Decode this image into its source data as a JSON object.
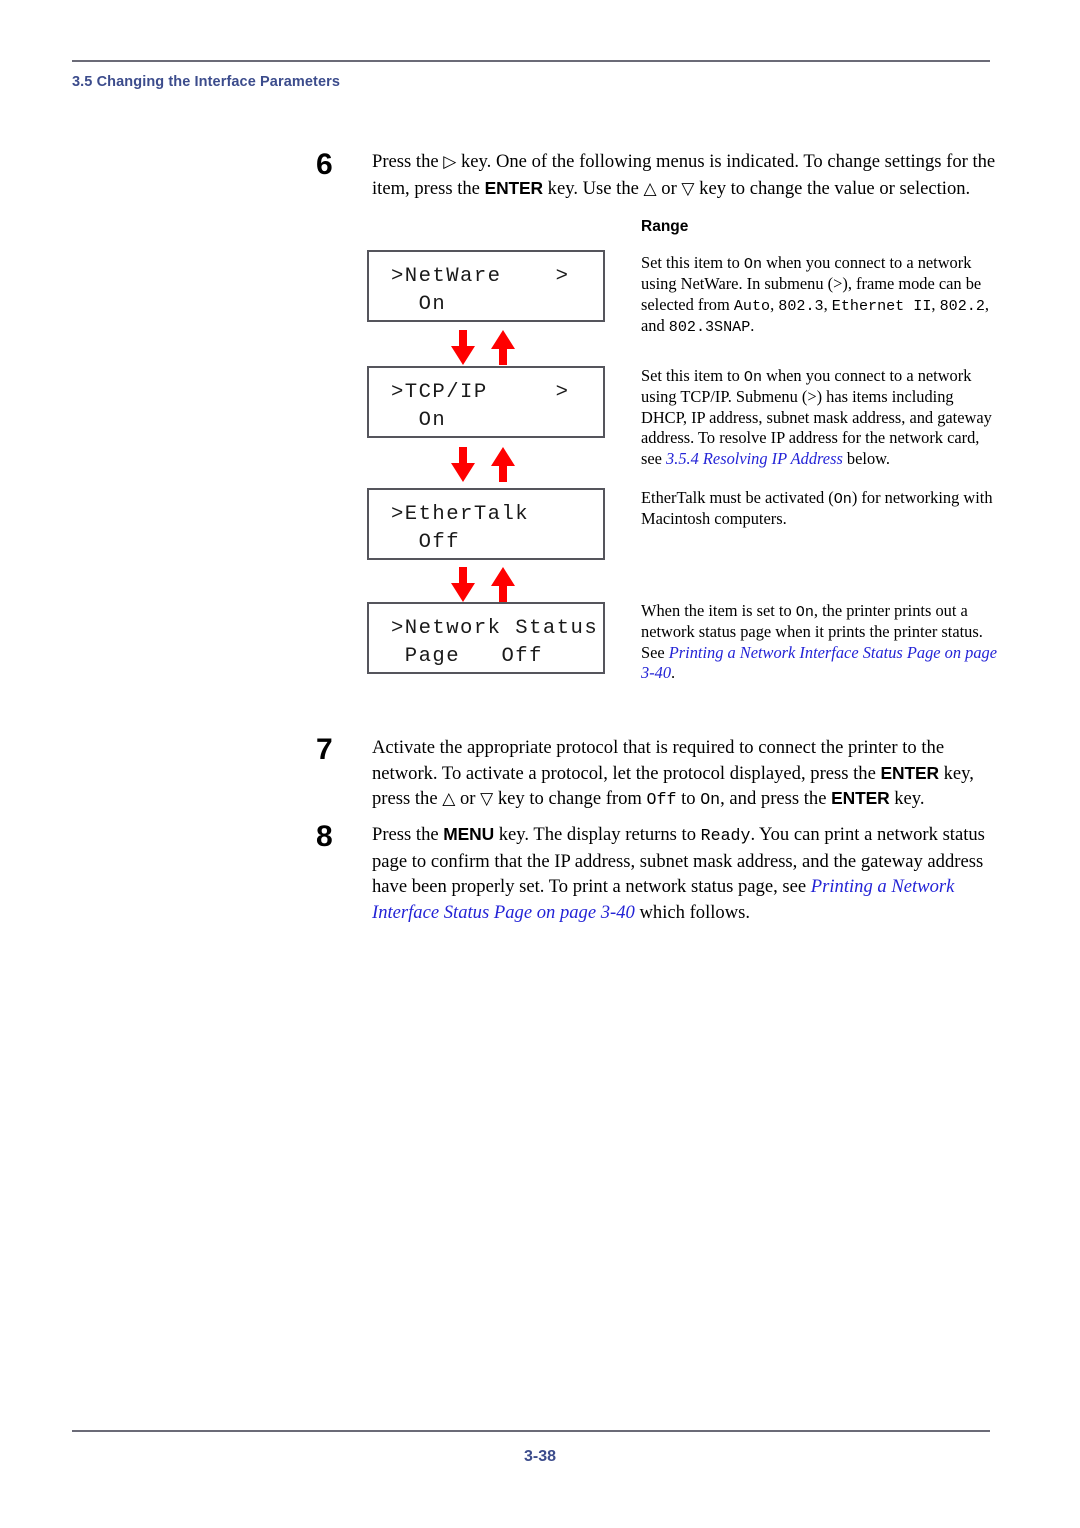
{
  "page": {
    "header_title": "3.5 Changing the Interface Parameters",
    "footer_page_number": "3-38",
    "accent_color": "#3c4c8c",
    "link_color": "#2323d6",
    "arrow_color": "#ff0000",
    "lcd_border_color": "#55555c"
  },
  "range_column": {
    "heading": "Range"
  },
  "steps": [
    {
      "number": "6",
      "text": "Press the ▷ key. One of the following menus is indicated. To change settings for the item, press the ENTER key. Use the △ or ▽ key to change the value or selection.",
      "parts": {
        "p1": "Press the ",
        "g1": "▷",
        "p2": " key. One of the following menus is indicated. To change settings for the item, press the ",
        "k1": "ENTER",
        "p3": " key. Use the ",
        "g2": "△",
        "p4": " or ",
        "g3": "▽",
        "p5": " key to change the value or selection."
      }
    },
    {
      "number": "7",
      "text": "Activate the appropriate protocol that is required to connect the printer to the network. To activate a protocol, let the protocol displayed, press the ENTER key, press the △ or ▽ key to change from Off to On, and press the ENTER key.",
      "parts": {
        "p1": "Activate the appropriate protocol that is required to connect the printer to the network. To activate a protocol, let the protocol displayed, press the ",
        "k1": "ENTER",
        "p2": " key, press the ",
        "g1": "△",
        "p3": " or ",
        "g2": "▽",
        "p4": " key to change from ",
        "m1": "Off",
        "p5": " to ",
        "m2": "On",
        "p6": ", and press the ",
        "k2": "ENTER",
        "p7": " key."
      }
    },
    {
      "number": "8",
      "text": "Press the MENU key. The display returns to Ready. You can print a network status page to confirm that the IP address, subnet mask address, and the gateway address have been properly set. To print a network status page, see Printing a Network Interface Status Page on page 3-40 which follows.",
      "parts": {
        "p1": "Press the ",
        "k1": "MENU",
        "p2": " key. The display returns to ",
        "m1": "Ready",
        "p3": ". You can print a network status page to confirm that the IP address, subnet mask address, and the gateway address have been properly set. To print a network status page, see ",
        "x1": "Printing a Network Interface Status Page on page 3-40",
        "p4": " which follows."
      }
    }
  ],
  "menu_rows": [
    {
      "lcd": {
        "line1": ">NetWare",
        "line2": "  On",
        "submenu_marker": ">"
      },
      "description": {
        "p1": "Set this item to ",
        "m1": "On",
        "p2": " when you connect to a network using NetWare. In submenu (>), frame mode can be selected from ",
        "m2": "Auto",
        "p3": ", ",
        "m3": "802.3",
        "p4": ", ",
        "m4": "Ethernet II",
        "p5": ", ",
        "m5": "802.2",
        "p6": ", and ",
        "m6": "802.3SNAP",
        "p7": "."
      }
    },
    {
      "lcd": {
        "line1": ">TCP/IP",
        "line2": "  On",
        "submenu_marker": ">"
      },
      "description": {
        "p1": "Set this item to ",
        "m1": "On",
        "p2": " when you connect to a network using TCP/IP. Submenu (>) has items including DHCP, IP address, subnet mask address, and gateway address. To resolve IP address for the network card, see ",
        "x1": "3.5.4 Resolving IP Address",
        "p3": " below."
      }
    },
    {
      "lcd": {
        "line1": ">EtherTalk",
        "line2": "  Off",
        "submenu_marker": ""
      },
      "description": {
        "p1": "EtherTalk must be activated (",
        "m1": "On",
        "p2": ") for networking with Macintosh computers."
      }
    },
    {
      "lcd": {
        "line1": ">Network Status",
        "line2": " Page   Off",
        "submenu_marker": ""
      },
      "description": {
        "p1": "When the item is set to ",
        "m1": "On",
        "p2": ", the printer prints out a network status page when it prints the printer status. See ",
        "x1": "Printing a Network Interface Status Page on page 3-40",
        "p3": "."
      }
    }
  ]
}
